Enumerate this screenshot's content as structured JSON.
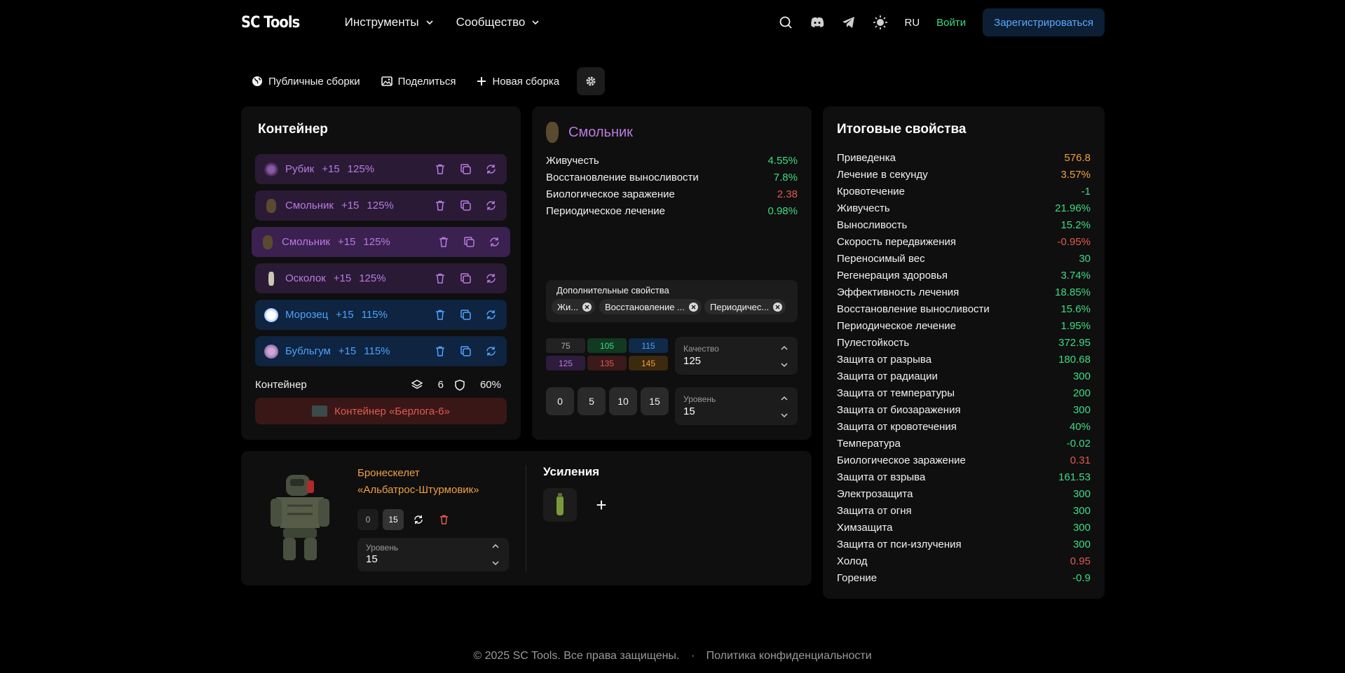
{
  "header": {
    "logo": "SC Tools",
    "nav": [
      {
        "label": "Инструменты"
      },
      {
        "label": "Сообщество"
      }
    ],
    "lang": "RU",
    "login": "Войти",
    "register": "Зарегистрироваться"
  },
  "toolbar": {
    "public_builds": "Публичные сборки",
    "share": "Поделиться",
    "new_build": "Новая сборка"
  },
  "container_panel": {
    "title": "Контейнер",
    "slots": [
      {
        "name": "Рубик",
        "level": "+15",
        "quality": "125%",
        "color": "#b87be0"
      },
      {
        "name": "Смольник",
        "level": "+15",
        "quality": "125%",
        "color": "#b87be0"
      },
      {
        "name": "Смольник",
        "level": "+15",
        "quality": "125%",
        "color": "#b87be0"
      },
      {
        "name": "Осколок",
        "level": "+15",
        "quality": "125%",
        "color": "#b87be0"
      },
      {
        "name": "Морозец",
        "level": "+15",
        "quality": "115%",
        "color": "#4da3ff"
      },
      {
        "name": "Бубльгум",
        "level": "+15",
        "quality": "115%",
        "color": "#4da3ff"
      }
    ],
    "container_label": "Контейнер",
    "slots_count": "6",
    "protection": "60%",
    "container_item": "Контейнер «Берлога-6»"
  },
  "artifact_panel": {
    "name": "Смольник",
    "properties": [
      {
        "label": "Живучесть",
        "value": "4.55%",
        "tone": "green"
      },
      {
        "label": "Восстановление выносливости",
        "value": "7.8%",
        "tone": "green"
      },
      {
        "label": "Биологическое заражение",
        "value": "2.38",
        "tone": "red"
      },
      {
        "label": "Периодическое лечение",
        "value": "0.98%",
        "tone": "green"
      }
    ],
    "extra_title": "Дополнительные свойства",
    "extra_chips": [
      "Жи...",
      "Восстановление ...",
      "Периодичес..."
    ],
    "quality_buttons": [
      "75",
      "105",
      "115",
      "125",
      "135",
      "145"
    ],
    "quality_label": "Качество",
    "quality_value": "125",
    "level_buttons": [
      "0",
      "5",
      "10",
      "15"
    ],
    "level_label": "Уровень",
    "level_value": "15"
  },
  "totals_panel": {
    "title": "Итоговые свойства",
    "rows": [
      {
        "label": "Приведенка",
        "value": "576.8",
        "tone": "orange"
      },
      {
        "label": "Лечение в секунду",
        "value": "3.57%",
        "tone": "orange"
      },
      {
        "label": "Кровотечение",
        "value": "-1",
        "tone": "green"
      },
      {
        "label": "Живучесть",
        "value": "21.96%",
        "tone": "green"
      },
      {
        "label": "Выносливость",
        "value": "15.2%",
        "tone": "green"
      },
      {
        "label": "Скорость передвижения",
        "value": "-0.95%",
        "tone": "red"
      },
      {
        "label": "Переносимый вес",
        "value": "30",
        "tone": "green"
      },
      {
        "label": "Регенерация здоровья",
        "value": "3.74%",
        "tone": "green"
      },
      {
        "label": "Эффективность лечения",
        "value": "18.85%",
        "tone": "green"
      },
      {
        "label": "Восстановление выносливости",
        "value": "15.6%",
        "tone": "green"
      },
      {
        "label": "Периодическое лечение",
        "value": "1.95%",
        "tone": "green"
      },
      {
        "label": "Пулестойкость",
        "value": "372.95",
        "tone": "green"
      },
      {
        "label": "Защита от разрыва",
        "value": "180.68",
        "tone": "green"
      },
      {
        "label": "Защита от радиации",
        "value": "300",
        "tone": "green"
      },
      {
        "label": "Защита от температуры",
        "value": "200",
        "tone": "green"
      },
      {
        "label": "Защита от биозаражения",
        "value": "300",
        "tone": "green"
      },
      {
        "label": "Защита от кровотечения",
        "value": "40%",
        "tone": "green"
      },
      {
        "label": "Температура",
        "value": "-0.02",
        "tone": "green"
      },
      {
        "label": "Биологическое заражение",
        "value": "0.31",
        "tone": "red"
      },
      {
        "label": "Защита от взрыва",
        "value": "161.53",
        "tone": "green"
      },
      {
        "label": "Электрозащита",
        "value": "300",
        "tone": "green"
      },
      {
        "label": "Защита от огня",
        "value": "300",
        "tone": "green"
      },
      {
        "label": "Химзащита",
        "value": "300",
        "tone": "green"
      },
      {
        "label": "Защита от пси-излучения",
        "value": "300",
        "tone": "green"
      },
      {
        "label": "Холод",
        "value": "0.95",
        "tone": "red"
      },
      {
        "label": "Горение",
        "value": "-0.9",
        "tone": "green"
      }
    ]
  },
  "armor_panel": {
    "name_line1": "Бронескелет",
    "name_line2": "«Альбатрос-Штурмовик»",
    "level_buttons": [
      "0",
      "15"
    ],
    "level_label": "Уровень",
    "level_value": "15",
    "boost_title": "Усиления",
    "add": "+"
  },
  "footer": {
    "copyright": "© 2025 SC Tools. Все права защищены.",
    "separator": "·",
    "privacy": "Политика конфиденциальности"
  },
  "colors": {
    "green": "#3ddc84",
    "red": "#e05a4f",
    "orange": "#f0a040",
    "purple": "#b87be0",
    "blue": "#4da3ff"
  }
}
